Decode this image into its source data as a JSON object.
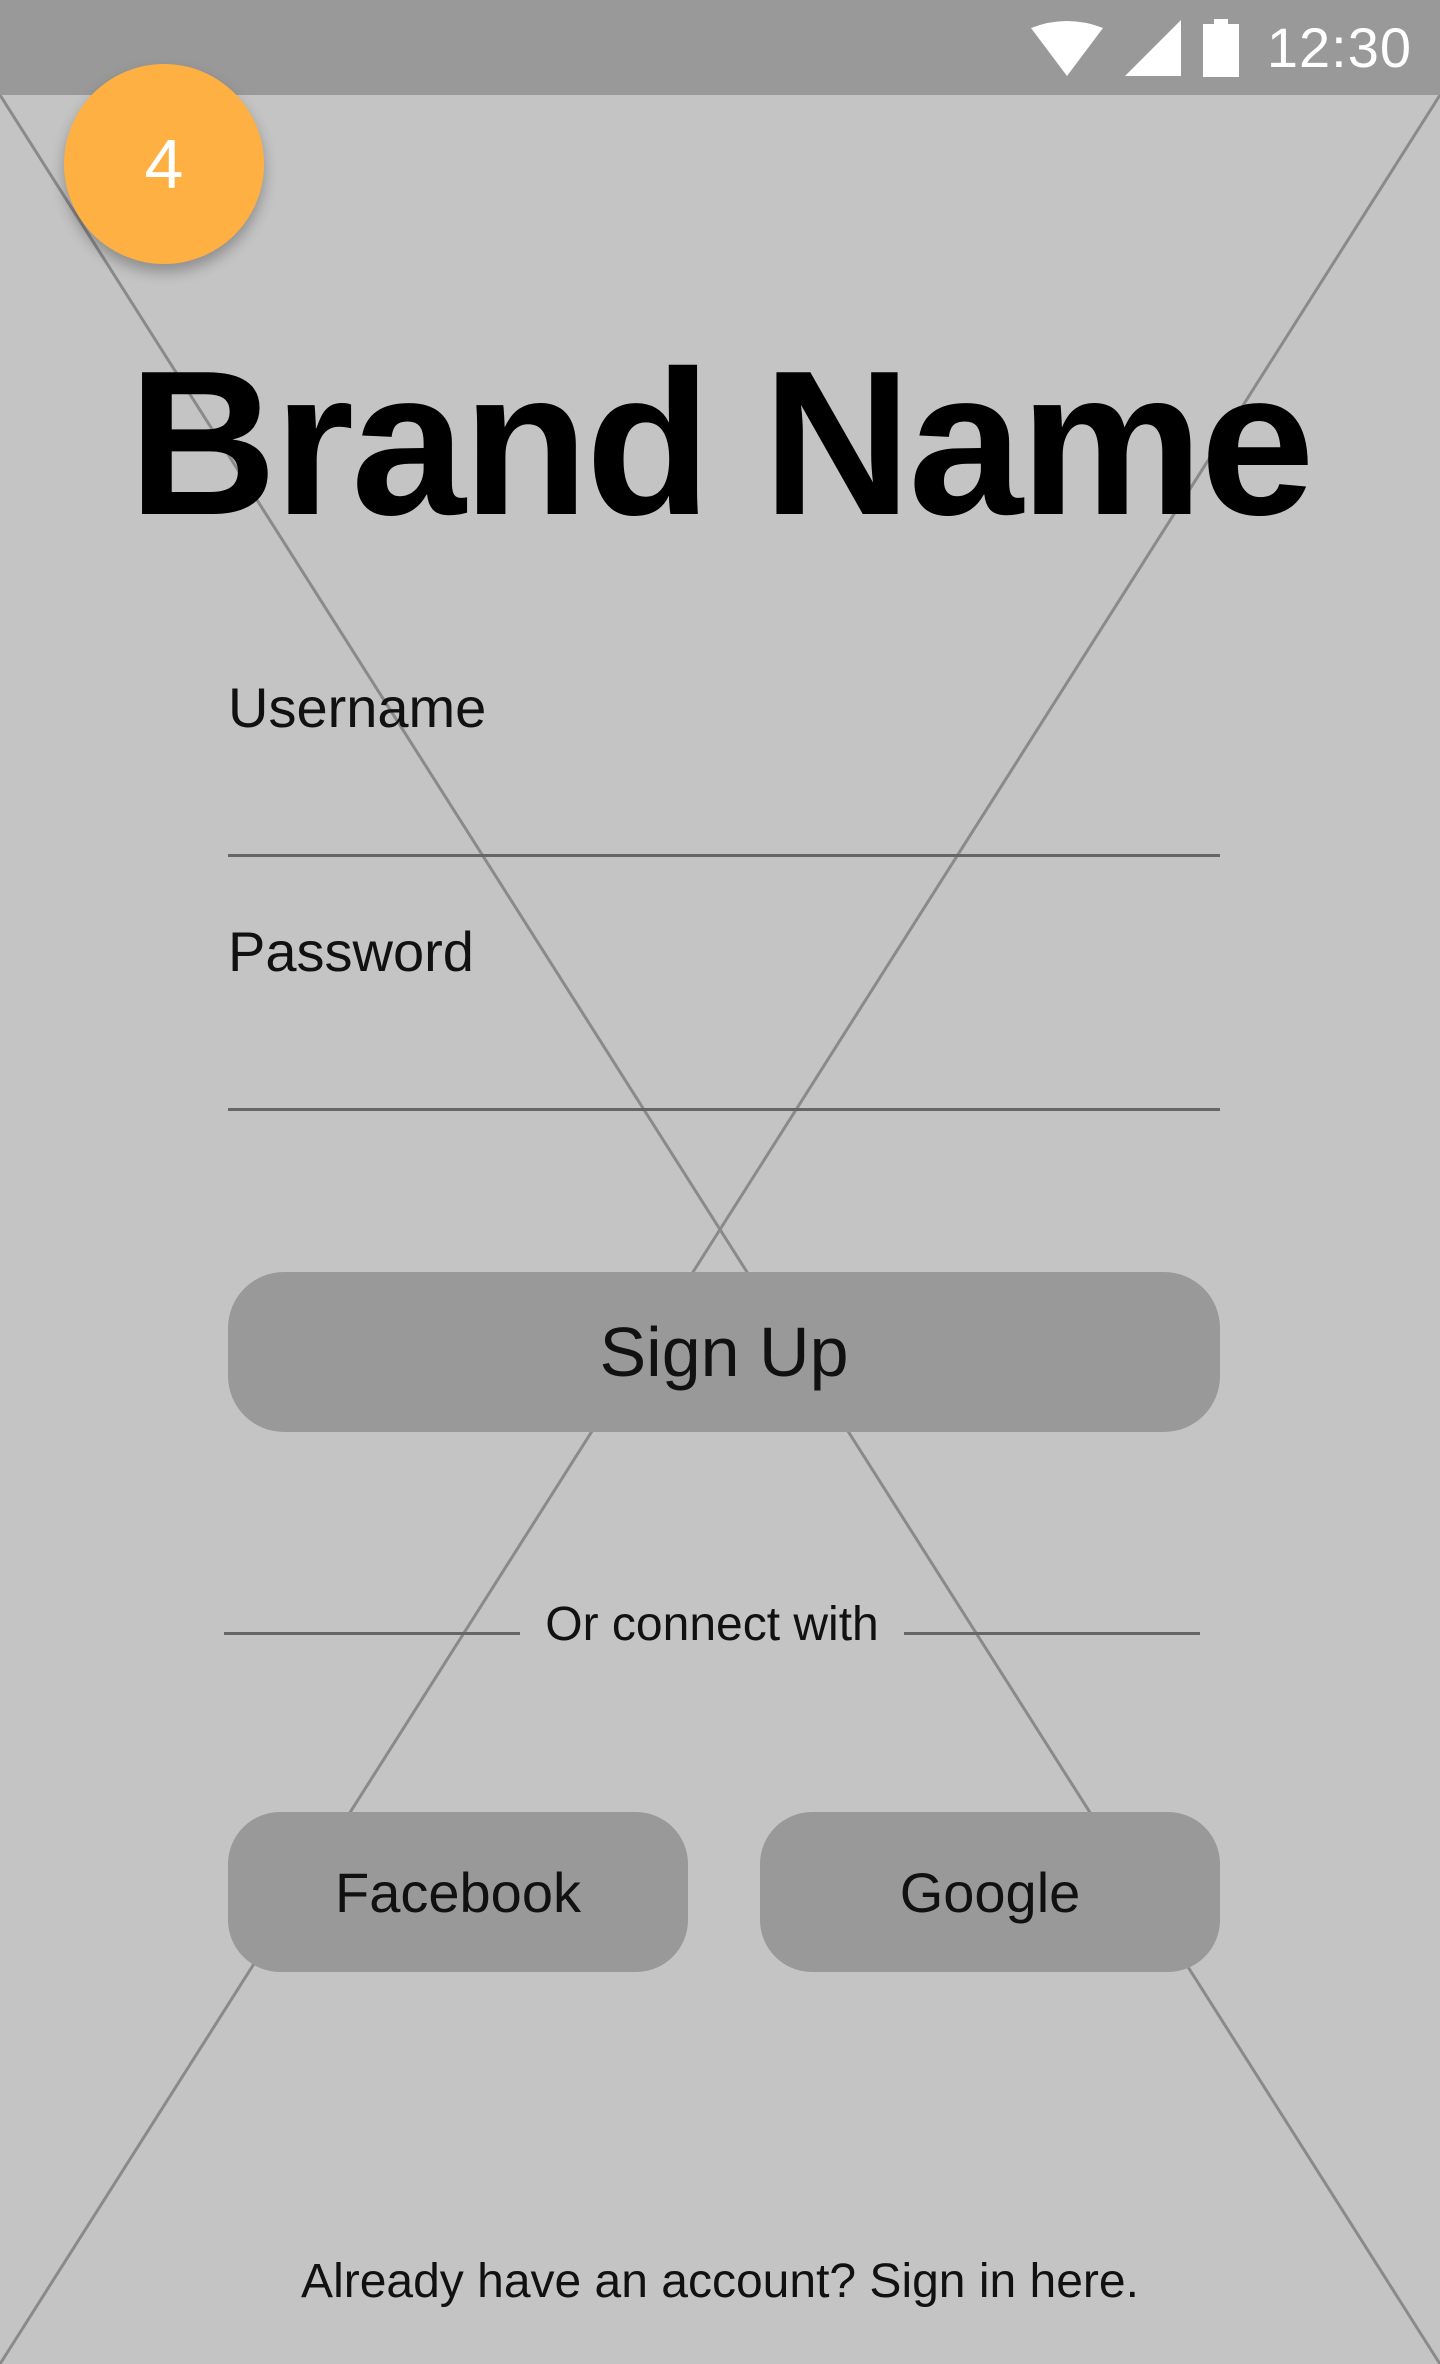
{
  "status_bar": {
    "time": "12:30",
    "icons": [
      "wifi-icon",
      "cellular-signal-icon",
      "battery-icon"
    ]
  },
  "step_badge": "4",
  "brand": {
    "title": "Brand Name"
  },
  "form": {
    "username_label": "Username",
    "username_value": "",
    "password_label": "Password",
    "password_value": ""
  },
  "actions": {
    "signup_label": "Sign Up",
    "divider_text": "Or connect with",
    "facebook_label": "Facebook",
    "google_label": "Google",
    "signin_text": "Already have an account? Sign in here."
  },
  "colors": {
    "background": "#c4c4c4",
    "status_bar": "#999999",
    "button": "#999999",
    "badge": "#ffb042",
    "text": "#111111"
  }
}
